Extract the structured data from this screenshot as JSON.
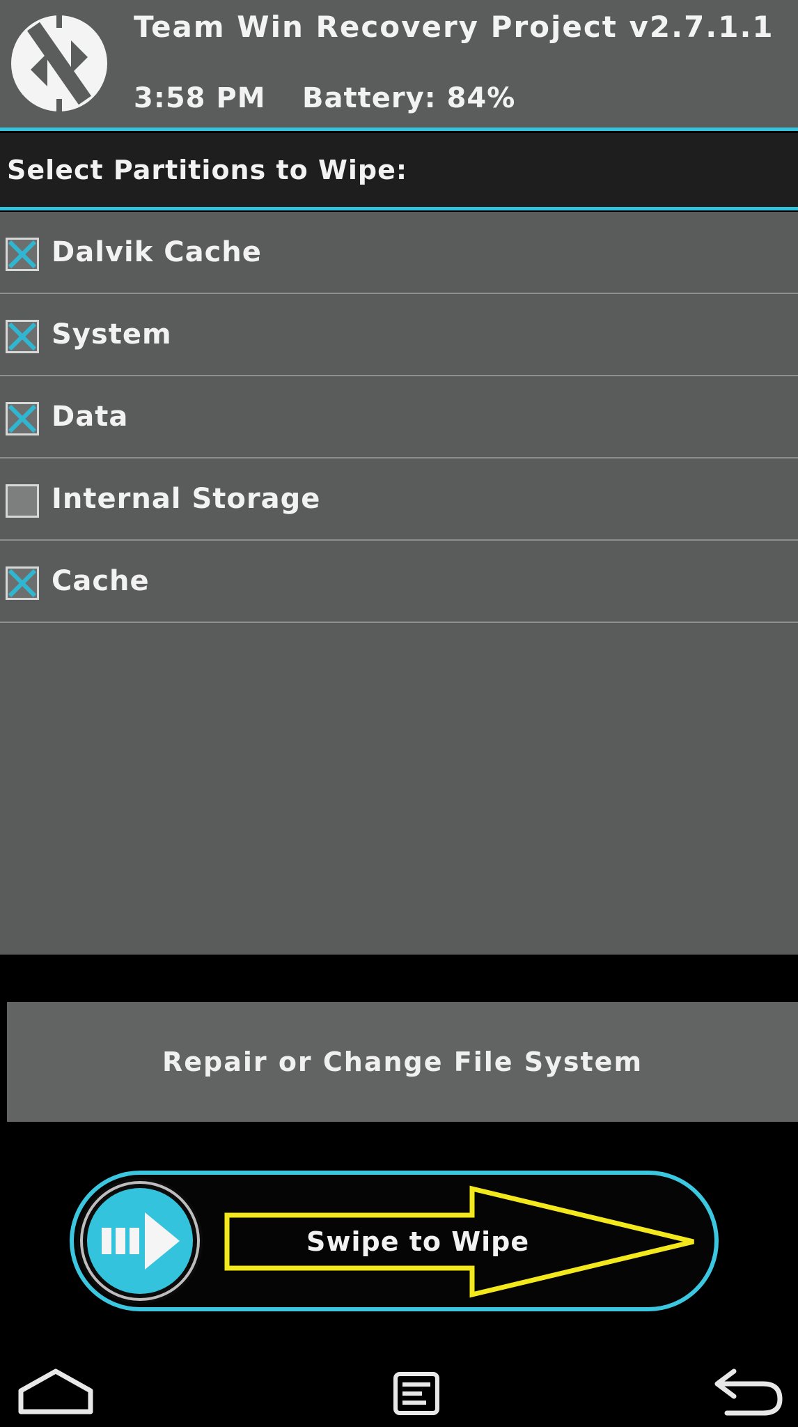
{
  "header": {
    "title": "Team Win Recovery Project  v2.7.1.1",
    "time": "3:58 PM",
    "battery": "Battery: 84%"
  },
  "section": {
    "title": "Select Partitions to Wipe:"
  },
  "partitions": [
    {
      "label": "Dalvik Cache",
      "checked": true
    },
    {
      "label": "System",
      "checked": true
    },
    {
      "label": "Data",
      "checked": true
    },
    {
      "label": "Internal Storage",
      "checked": false
    },
    {
      "label": "Cache",
      "checked": true
    }
  ],
  "actions": {
    "repair_label": "Repair or Change File System",
    "swipe_label": "Swipe to Wipe"
  },
  "nav": {
    "home": "home-icon",
    "console": "console-icon",
    "back": "back-icon"
  },
  "colors": {
    "accent": "#34c3dc",
    "arrow_outline": "#f2e81c",
    "panel": "#5a5c5b"
  }
}
